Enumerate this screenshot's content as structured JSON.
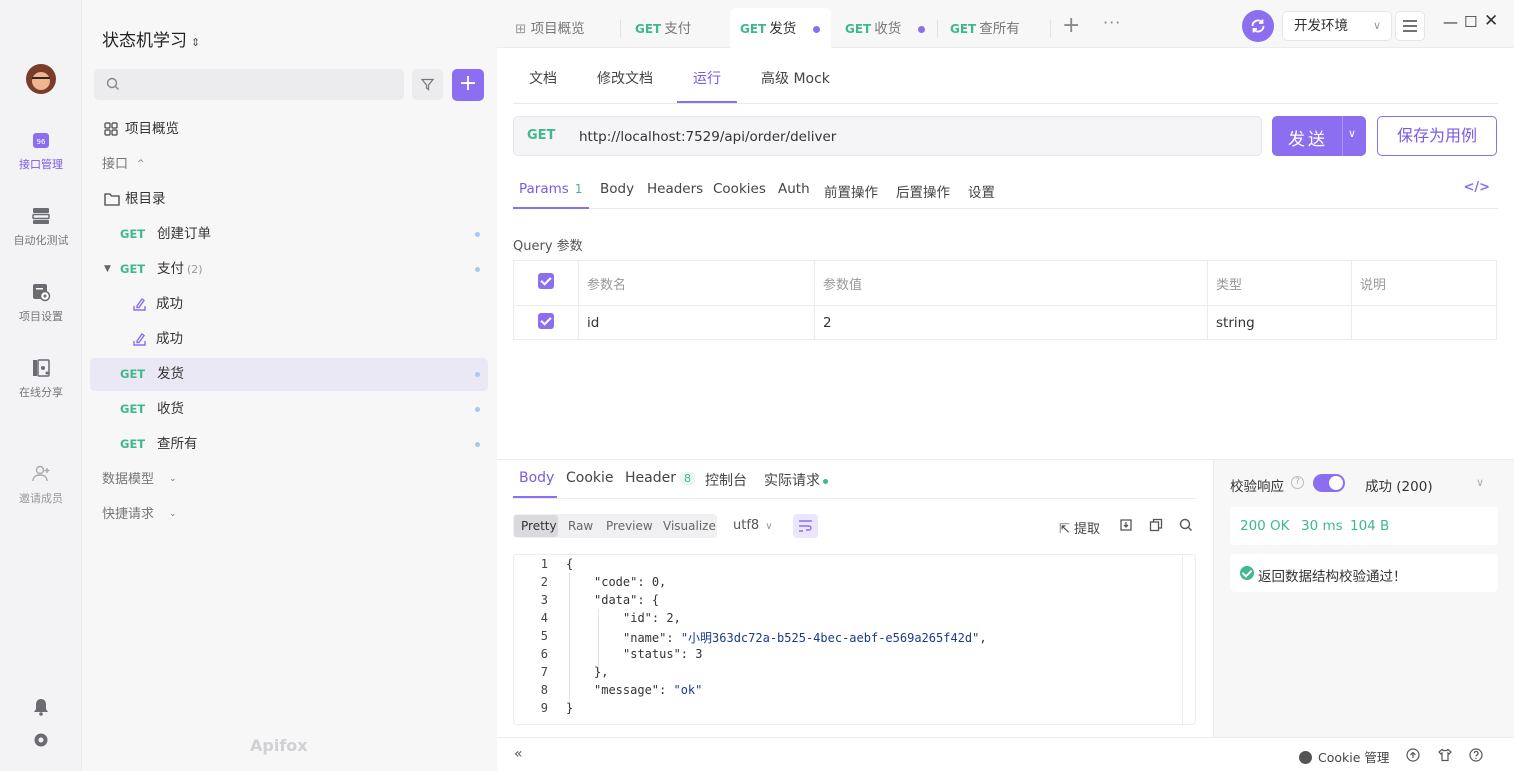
{
  "rail": {
    "items": [
      {
        "label": "接口管理",
        "icon": "api-management-icon"
      },
      {
        "label": "自动化测试",
        "icon": "automation-test-icon"
      },
      {
        "label": "项目设置",
        "icon": "project-settings-icon"
      },
      {
        "label": "在线分享",
        "icon": "online-share-icon"
      },
      {
        "label": "邀请成员",
        "icon": "invite-member-icon"
      }
    ]
  },
  "sidebar": {
    "project_name": "状态机学习",
    "project_switch_icon": "updown-chevron-icon",
    "overview": "项目概览",
    "interface_group": "接口",
    "root_folder": "根目录",
    "tree": [
      {
        "method": "GET",
        "name": "创建订单"
      },
      {
        "method": "GET",
        "name": "支付",
        "count": "(2)"
      },
      {
        "name": "成功"
      },
      {
        "name": "成功"
      },
      {
        "method": "GET",
        "name": "发货"
      },
      {
        "method": "GET",
        "name": "收货"
      },
      {
        "method": "GET",
        "name": "查所有"
      }
    ],
    "data_models": "数据模型",
    "quick_requests": "快捷请求",
    "brand": "Apifox"
  },
  "tabs": {
    "items": [
      {
        "label": "项目概览"
      },
      {
        "method": "GET",
        "label": "支付"
      },
      {
        "method": "GET",
        "label": "发货"
      },
      {
        "method": "GET",
        "label": "收货"
      },
      {
        "method": "GET",
        "label": "查所有"
      }
    ],
    "more": "···"
  },
  "env": {
    "label": "开发环境"
  },
  "doc_tabs": [
    "文档",
    "修改文档",
    "运行",
    "高级 Mock"
  ],
  "request": {
    "method": "GET",
    "url": "http://localhost:7529/api/order/deliver",
    "send_label": "发送",
    "save_label": "保存为用例"
  },
  "param_tabs": {
    "params": "Params",
    "params_count": "1",
    "others": [
      "Body",
      "Headers",
      "Cookies",
      "Auth",
      "前置操作",
      "后置操作",
      "设置"
    ]
  },
  "query": {
    "title": "Query 参数",
    "headers": [
      "参数名",
      "参数值",
      "类型",
      "说明"
    ],
    "rows": [
      {
        "name": "id",
        "value": "2",
        "type": "string",
        "desc": ""
      }
    ]
  },
  "response": {
    "tabs": {
      "body": "Body",
      "cookie": "Cookie",
      "header": "Header",
      "header_count": "8",
      "console": "控制台",
      "actual": "实际请求"
    },
    "formats": [
      "Pretty",
      "Raw",
      "Preview",
      "Visualize"
    ],
    "encoding": "utf8",
    "extract": "提取",
    "lines": [
      "1",
      "2",
      "3",
      "4",
      "5",
      "6",
      "7",
      "8",
      "9"
    ],
    "json_text": {
      "l1": "{",
      "l2_key": "\"code\"",
      "l2_val": "0,",
      "l3_key": "\"data\"",
      "l3_val": "{",
      "l4_key": "\"id\"",
      "l4_val": "2,",
      "l5_key": "\"name\"",
      "l5_val": "\"小明363dc72a-b525-4bec-aebf-e569a265f42d\"",
      "l5_tail": ",",
      "l6_key": "\"status\"",
      "l6_val": "3",
      "l7": "},",
      "l8_key": "\"message\"",
      "l8_val": "\"ok\"",
      "l9": "}"
    }
  },
  "validation": {
    "label": "校验响应",
    "selected": "成功 (200)",
    "status": "200 OK",
    "time": "30 ms",
    "size": "104 B",
    "result": "返回数据结构校验通过！"
  },
  "bottom": {
    "cookie_manage": "Cookie 管理"
  },
  "colors": {
    "accent": "#8c6ff0",
    "method_get": "#3fb88d"
  }
}
